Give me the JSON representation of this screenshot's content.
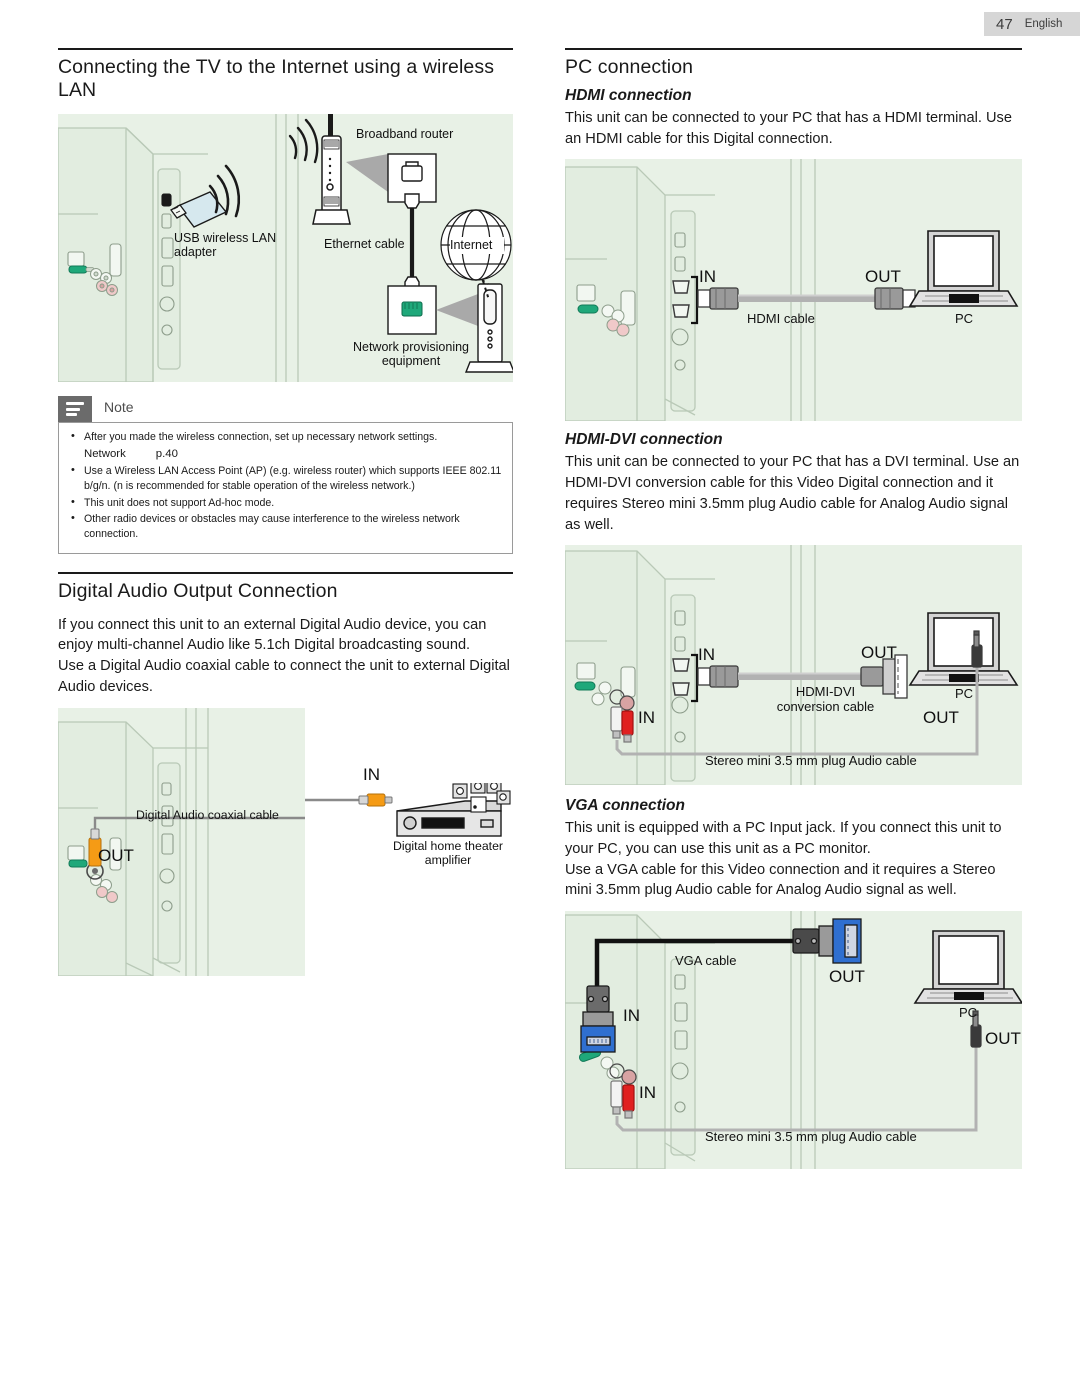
{
  "header": {
    "page_number": "47",
    "language": "English"
  },
  "left_column": {
    "section_title": "Connecting the TV to the Internet using a wireless LAN",
    "wireless_figure": {
      "labels": {
        "usb_adapter": "USB wireless LAN",
        "usb_adapter_2": "adapter",
        "broadband_router": "Broadband router",
        "ethernet_cable": "Ethernet cable",
        "internet": "Internet",
        "network_equipment": "Network provisioning",
        "network_equipment_2": "equipment"
      }
    },
    "note": {
      "label": "Note",
      "items": [
        "After you made the wireless connection, set up necessary network settings.",
        "Use a Wireless LAN Access Point (AP) (e.g. wireless router) which supports IEEE 802.11 b/g/n. (n is recommended for stable operation of the wireless network.)",
        "This unit does not support Ad-hoc mode.",
        "Other radio devices or obstacles may cause interference to the wireless network connection."
      ],
      "network_link_label": "Network",
      "network_link_page": "p.40"
    },
    "audio_section": {
      "title": "Digital Audio Output Connection",
      "paragraph_1": "If you connect this unit to an external Digital Audio device, you can enjoy multi-channel Audio like 5.1ch Digital broadcasting sound.",
      "paragraph_2": "Use a Digital Audio coaxial cable to connect the unit to external Digital Audio devices.",
      "figure_labels": {
        "cable": "Digital Audio coaxial cable",
        "in": "IN",
        "out": "OUT",
        "amplifier": "Digital home theater",
        "amplifier_2": "amplifier"
      }
    }
  },
  "right_column": {
    "section_title": "PC connection",
    "hdmi": {
      "sub_title": "HDMI connection",
      "paragraph": "This unit can be connected to your PC that has a HDMI terminal. Use an HDMI cable for this Digital connection.",
      "figure_labels": {
        "in": "IN",
        "out": "OUT",
        "cable": "HDMI cable",
        "pc": "PC"
      }
    },
    "hdmi_dvi": {
      "sub_title": "HDMI-DVI connection",
      "paragraph": "This unit can be connected to your PC that has a DVI terminal. Use an HDMI-DVI conversion cable for this Video Digital connection and it requires Stereo mini 3.5mm plug Audio cable for Analog Audio signal as well.",
      "figure_labels": {
        "in_video": "IN",
        "out_video": "OUT",
        "cable_line1": "HDMI-DVI",
        "cable_line2": "conversion cable",
        "pc": "PC",
        "in_audio": "IN",
        "out_audio": "OUT",
        "audio_cable": "Stereo mini 3.5 mm plug Audio cable"
      }
    },
    "vga": {
      "sub_title": "VGA connection",
      "paragraph_1": "This unit is equipped with a PC Input jack. If you connect this unit to your PC, you can use this unit as a PC monitor.",
      "paragraph_2": "Use a VGA cable for this Video connection and it requires a Stereo mini 3.5mm plug Audio cable for Analog Audio signal as well.",
      "figure_labels": {
        "cable": "VGA cable",
        "in_video": "IN",
        "out_video": "OUT",
        "pc": "PC",
        "in_audio": "IN",
        "out_audio": "OUT",
        "audio_cable": "Stereo mini 3.5 mm plug Audio cable"
      }
    }
  },
  "colors": {
    "figure_background": "#e8f1e6",
    "note_tab": "#6b6b6b",
    "header_background": "#d6d6d6",
    "coax_orange": "#f59b15",
    "vga_blue": "#2f6fd0",
    "rca_red": "#e02020",
    "antenna_green": "#1fa87a"
  }
}
